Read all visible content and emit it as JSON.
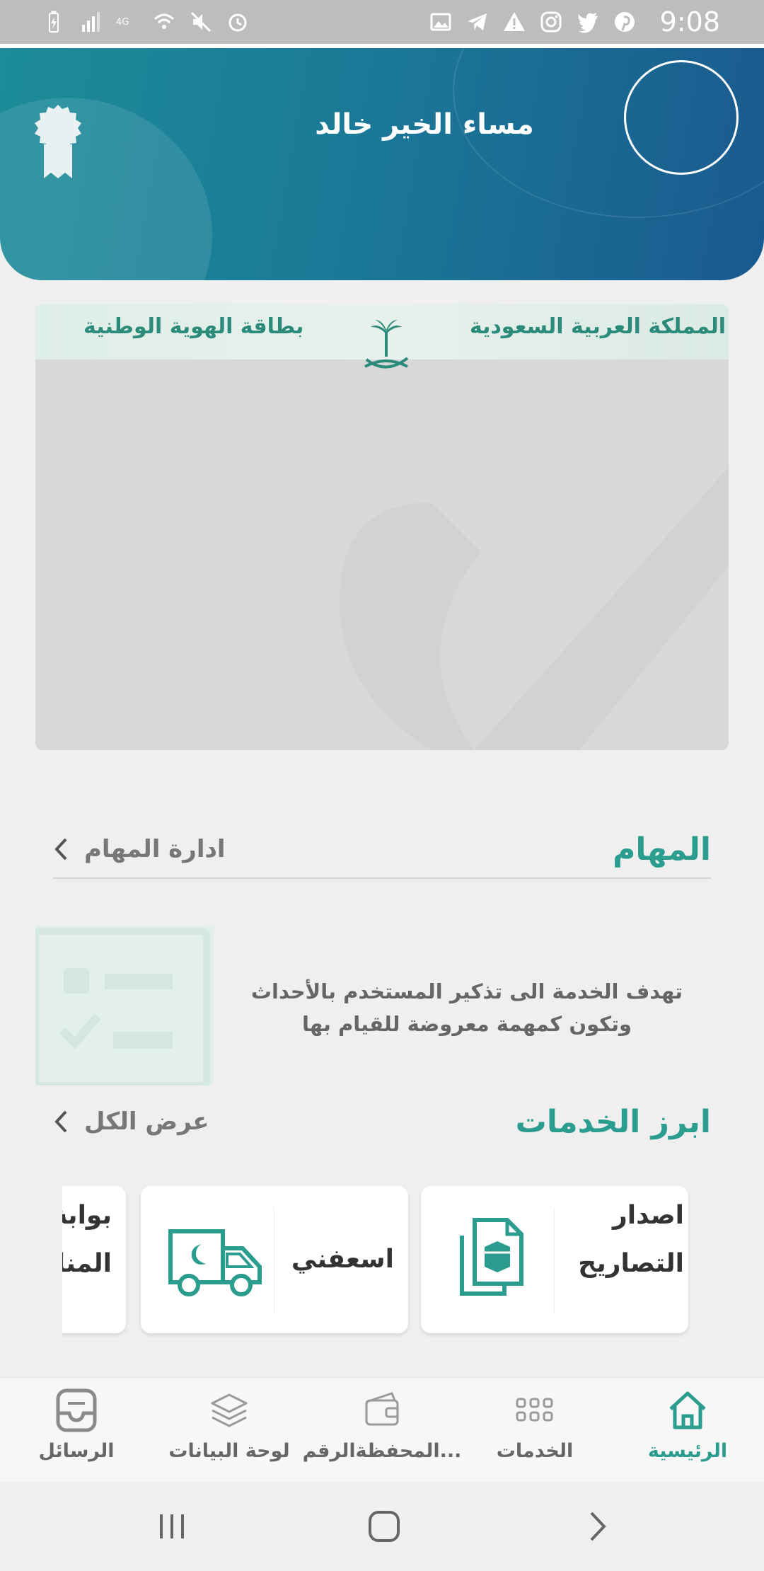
{
  "status_bar": {
    "time": "9:08",
    "left_icons": [
      "battery-charging-icon",
      "signal-bars-icon",
      "volte-icon",
      "wifi-icon",
      "mute-icon",
      "alarm-icon"
    ],
    "right_icons": [
      "gallery-icon",
      "telegram-icon",
      "warning-icon",
      "instagram-icon",
      "twitter-icon",
      "pinterest-icon"
    ]
  },
  "header": {
    "greeting": "مساء الخير خالد",
    "gradient_colors": [
      "#1c8c98",
      "#1a5a8f"
    ]
  },
  "id_card": {
    "kingdom": "المملكة العربية السعودية",
    "card_title": "بطاقة الهوية الوطنية"
  },
  "tasks": {
    "title": "المهام",
    "manage_link": "ادارة المهام",
    "description": "تهدف الخدمة الى تذكير المستخدم بالأحداث وتكون كمهمة معروضة للقيام بها"
  },
  "services": {
    "title": "ابرز الخدمات",
    "view_all": "عرض الكل",
    "items": [
      {
        "label_line1": "اصدار",
        "label_line2": "التصاريح",
        "icon": "permits-icon"
      },
      {
        "label": "اسعفني",
        "icon": "ambulance-icon"
      },
      {
        "label_line1": "بوابة",
        "label_line2": "المناسبات",
        "icon": ""
      }
    ]
  },
  "bottom_nav": {
    "items": [
      {
        "label": "الرئيسية",
        "icon": "home-icon",
        "active": true
      },
      {
        "label": "الخدمات",
        "icon": "grid-icon",
        "active": false
      },
      {
        "label": "المحفظةالرقم...",
        "icon": "wallet-icon",
        "active": false
      },
      {
        "label": "لوحة البيانات",
        "icon": "layers-icon",
        "active": false
      },
      {
        "label": "الرسائل",
        "icon": "inbox-icon",
        "active": false
      }
    ]
  },
  "colors": {
    "accent": "#2a9d8f",
    "page_background": "#efefef"
  }
}
